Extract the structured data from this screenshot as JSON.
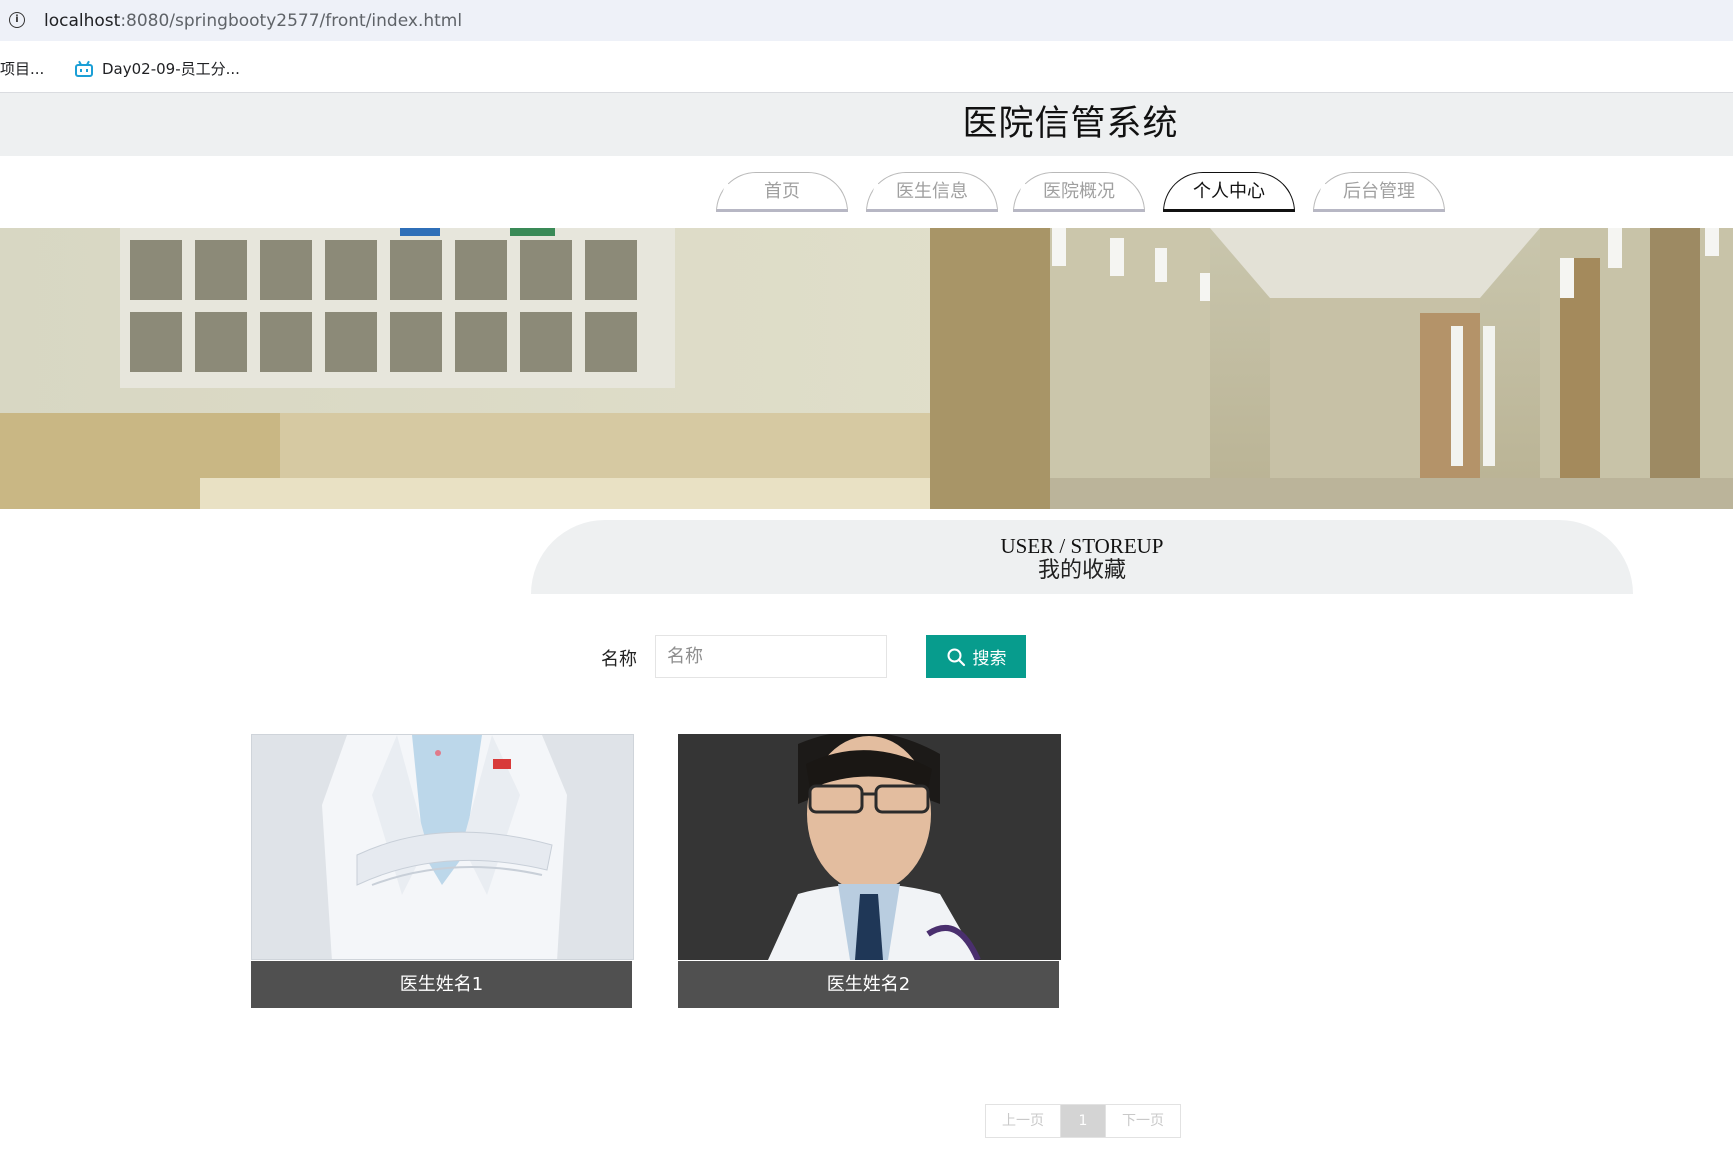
{
  "browser": {
    "url_host": "localhost",
    "url_path": ":8080/springbooty2577/front/index.html",
    "info_icon": "info-icon",
    "bookmarks": [
      {
        "label": "项目...",
        "icon": ""
      },
      {
        "label": "Day02-09-员工分...",
        "icon": "bilibili-icon"
      }
    ]
  },
  "header": {
    "title": "医院信管系统"
  },
  "nav": {
    "tabs": [
      {
        "label": "首页",
        "active": false
      },
      {
        "label": "医生信息",
        "active": false
      },
      {
        "label": "医院概况",
        "active": false
      },
      {
        "label": "个人中心",
        "active": true
      },
      {
        "label": "后台管理",
        "active": false
      }
    ]
  },
  "section": {
    "title_en": "USER / STOREUP",
    "title_cn": "我的收藏"
  },
  "search": {
    "label": "名称",
    "placeholder": "名称",
    "value": "",
    "button_label": "搜索",
    "button_icon": "search-icon",
    "button_color": "#079c8d"
  },
  "cards": [
    {
      "caption": "医生姓名1"
    },
    {
      "caption": "医生姓名2"
    }
  ],
  "pagination": {
    "prev_label": "上一页",
    "current_page": "1",
    "next_label": "下一页"
  }
}
